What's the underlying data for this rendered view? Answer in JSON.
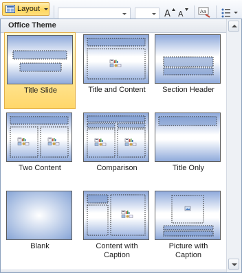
{
  "ribbon": {
    "layout_button": {
      "label": "Layout",
      "icon": "layout-icon"
    },
    "font_name_value": "",
    "font_size_value": "",
    "icons": [
      "grow-font-icon",
      "shrink-font-icon",
      "clear-formatting-icon",
      "bullets-icon"
    ]
  },
  "gallery": {
    "section_title": "Office Theme",
    "selected_index": 0,
    "layouts": [
      {
        "label": "Title Slide",
        "kind": "title-slide"
      },
      {
        "label": "Title and Content",
        "kind": "title-content"
      },
      {
        "label": "Section Header",
        "kind": "section-header"
      },
      {
        "label": "Two Content",
        "kind": "two-content"
      },
      {
        "label": "Comparison",
        "kind": "comparison"
      },
      {
        "label": "Title Only",
        "kind": "title-only"
      },
      {
        "label": "Blank",
        "kind": "blank"
      },
      {
        "label": "Content with Caption",
        "kind": "content-caption"
      },
      {
        "label": "Picture with Caption",
        "kind": "picture-caption"
      }
    ]
  },
  "colors": {
    "selection_border": "#e3b04a",
    "selection_fill": "#ffe594",
    "slide_blue": "#b8c9e8",
    "panel_border": "#8aa0bd"
  }
}
